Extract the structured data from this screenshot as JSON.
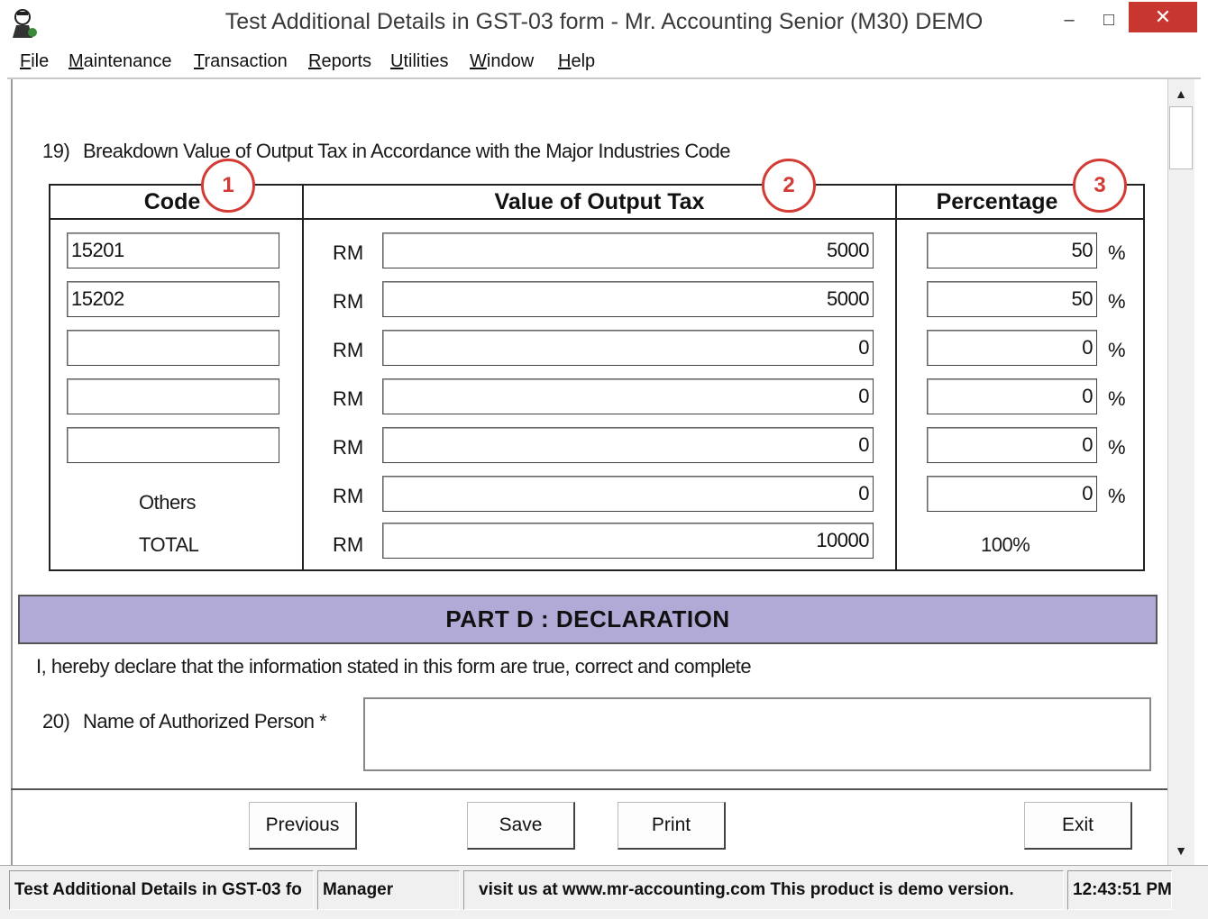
{
  "window": {
    "title": "Test Additional Details in GST-03 form - Mr. Accounting Senior (M30) DEMO",
    "min_glyph": "–",
    "max_glyph": "□",
    "close_glyph": "✕"
  },
  "menu": {
    "items": [
      {
        "label": "File"
      },
      {
        "label": "Maintenance"
      },
      {
        "label": "Transaction"
      },
      {
        "label": "Reports"
      },
      {
        "label": "Utilities"
      },
      {
        "label": "Window"
      },
      {
        "label": "Help"
      }
    ]
  },
  "section19": {
    "number": "19)",
    "label": "Breakdown Value of Output Tax in Accordance with the Major Industries Code",
    "columns": {
      "code": "Code",
      "value": "Value of Output Tax",
      "percentage": "Percentage"
    },
    "callouts": [
      "1",
      "2",
      "3"
    ],
    "currency": "RM",
    "pct_sign": "%",
    "rows": [
      {
        "code": "15201",
        "value": "5000",
        "pct": "50"
      },
      {
        "code": "15202",
        "value": "5000",
        "pct": "50"
      },
      {
        "code": "",
        "value": "0",
        "pct": "0"
      },
      {
        "code": "",
        "value": "0",
        "pct": "0"
      },
      {
        "code": "",
        "value": "0",
        "pct": "0"
      }
    ],
    "others": {
      "label": "Others",
      "value": "0",
      "pct": "0"
    },
    "total": {
      "label": "TOTAL",
      "value": "10000",
      "pct": "100%"
    }
  },
  "partd": {
    "heading": "PART D : DECLARATION",
    "declaration": "I, hereby declare that the information stated in this form are true, correct and complete",
    "q20_number": "20)",
    "q20_label": "Name of Authorized Person *",
    "name_value": ""
  },
  "buttons": {
    "previous": "Previous",
    "save": "Save",
    "print": "Print",
    "exit": "Exit"
  },
  "statusbar": {
    "window": "Test Additional Details in GST-03 fo",
    "user": "Manager",
    "message": "visit us at www.mr-accounting.com This product is demo version.",
    "time": "12:43:51 PM"
  },
  "scrollbar": {
    "up": "▲",
    "down": "▼"
  }
}
